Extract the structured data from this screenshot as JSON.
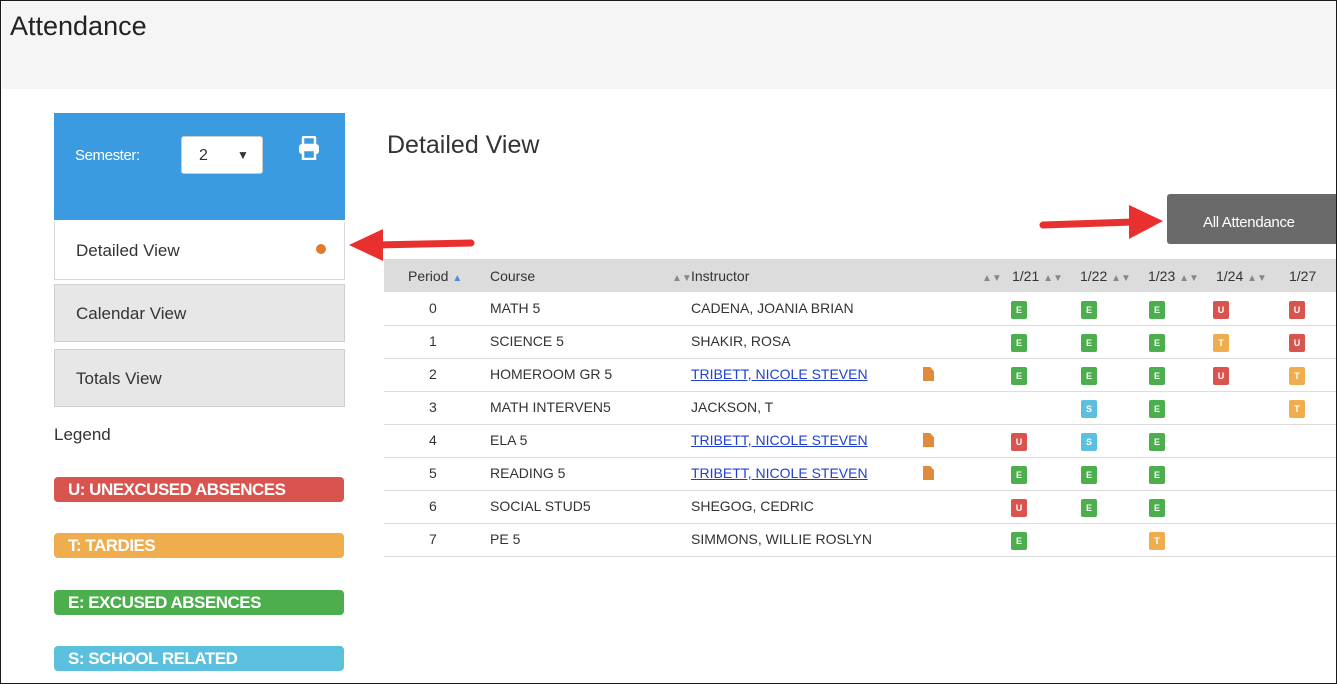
{
  "page": {
    "title": "Attendance"
  },
  "sidebar": {
    "semester_label": "Semester:",
    "semester_value": "2",
    "nav": [
      {
        "label": "Detailed View",
        "active": true
      },
      {
        "label": "Calendar View",
        "active": false
      },
      {
        "label": "Totals View",
        "active": false
      }
    ]
  },
  "legend": {
    "title": "Legend",
    "items": [
      {
        "label": "U: UNEXCUSED ABSENCES",
        "color": "#d9534f"
      },
      {
        "label": "T: TARDIES",
        "color": "#f0ad4e"
      },
      {
        "label": "E: EXCUSED ABSENCES",
        "color": "#4cae4c"
      },
      {
        "label": "S: SCHOOL RELATED",
        "color": "#5bc0de"
      }
    ]
  },
  "main": {
    "title": "Detailed View",
    "all_attendance_button": "All Attendance",
    "table": {
      "headers": [
        "Period",
        "Course",
        "Instructor",
        "1/21",
        "1/22",
        "1/23",
        "1/24",
        "1/27"
      ],
      "rows": [
        {
          "period": "0",
          "course": "MATH 5",
          "instructor": "CADENA, JOANIA BRIAN",
          "link": false,
          "codes": [
            "E",
            "E",
            "E",
            "U",
            "U"
          ]
        },
        {
          "period": "1",
          "course": "SCIENCE 5",
          "instructor": "SHAKIR, ROSA",
          "link": false,
          "codes": [
            "E",
            "E",
            "E",
            "T",
            "U"
          ]
        },
        {
          "period": "2",
          "course": "HOMEROOM GR 5",
          "instructor": "TRIBETT, NICOLE STEVEN",
          "link": true,
          "codes": [
            "E",
            "E",
            "E",
            "U",
            "T"
          ]
        },
        {
          "period": "3",
          "course": "MATH INTERVEN5",
          "instructor": "JACKSON, T",
          "link": false,
          "codes": [
            "",
            "S",
            "E",
            "",
            "T"
          ]
        },
        {
          "period": "4",
          "course": "ELA 5",
          "instructor": "TRIBETT, NICOLE STEVEN",
          "link": true,
          "codes": [
            "U",
            "S",
            "E",
            "",
            ""
          ]
        },
        {
          "period": "5",
          "course": "READING 5",
          "instructor": "TRIBETT, NICOLE STEVEN",
          "link": true,
          "codes": [
            "E",
            "E",
            "E",
            "",
            ""
          ]
        },
        {
          "period": "6",
          "course": "SOCIAL STUD5",
          "instructor": "SHEGOG, CEDRIC",
          "link": false,
          "codes": [
            "U",
            "E",
            "E",
            "",
            ""
          ]
        },
        {
          "period": "7",
          "course": "PE 5",
          "instructor": "SIMMONS, WILLIE ROSLYN",
          "link": false,
          "codes": [
            "E",
            "",
            "T",
            "",
            ""
          ]
        }
      ]
    }
  },
  "colors": {
    "accent": "#3b9be0",
    "annotation_arrow": "#e8312f"
  }
}
